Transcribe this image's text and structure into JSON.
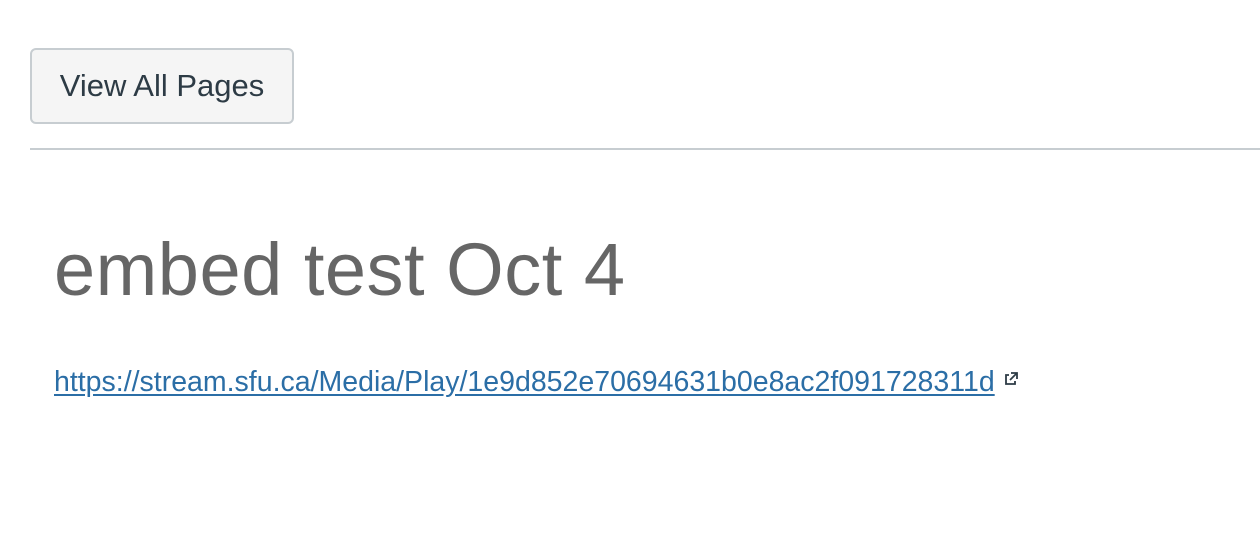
{
  "header": {
    "view_all_pages_label": "View All Pages"
  },
  "page": {
    "title": "embed test Oct 4",
    "link_text": "https://stream.sfu.ca/Media/Play/1e9d852e70694631b0e8ac2f091728311d",
    "link_href": "https://stream.sfu.ca/Media/Play/1e9d852e70694631b0e8ac2f091728311d",
    "link_icon": "external-link-icon"
  },
  "colors": {
    "link": "#2b6ea6",
    "title": "#666666",
    "button_bg": "#f5f5f5",
    "border": "#c7cdd1",
    "text": "#2d3b45"
  }
}
